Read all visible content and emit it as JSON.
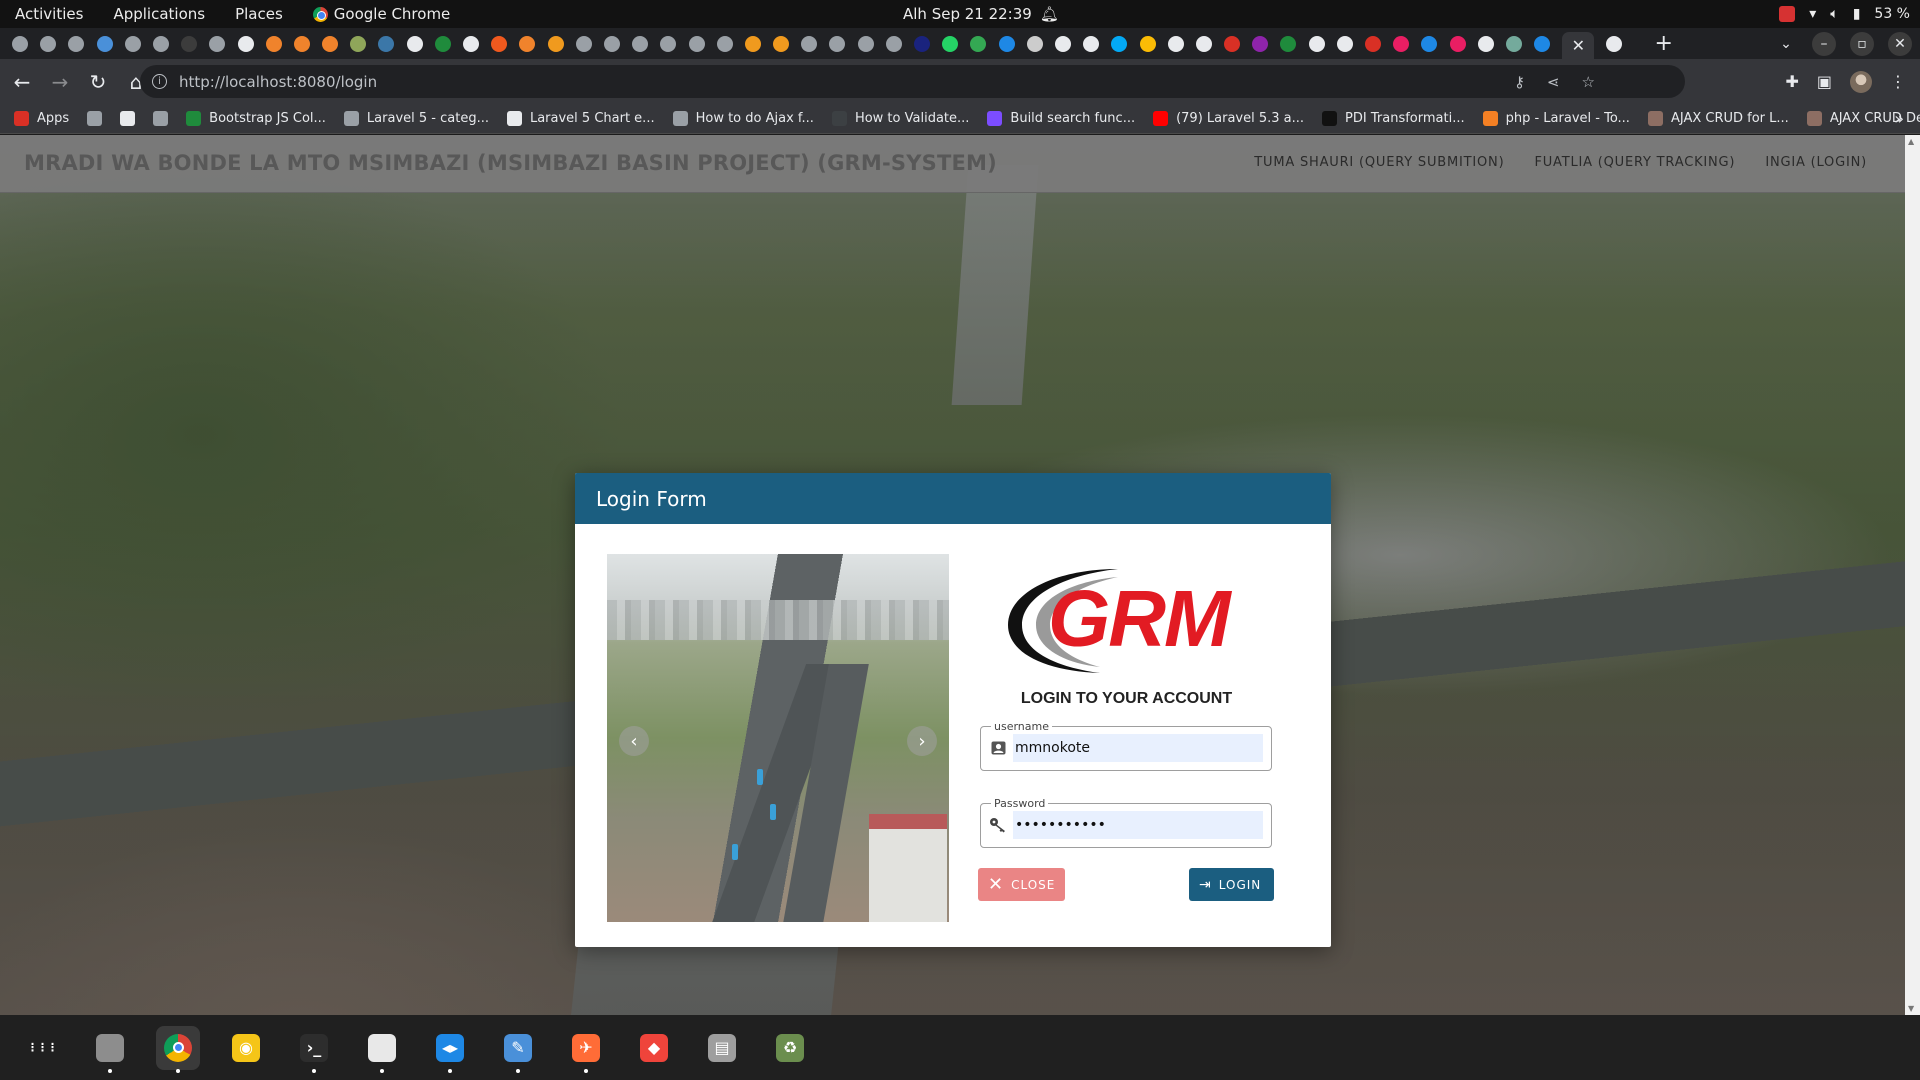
{
  "topbar": {
    "activities": "Activities",
    "applications": "Applications",
    "places": "Places",
    "app_name": "Google Chrome",
    "clock": "Alh Sep 21  22:39",
    "battery": "53 %"
  },
  "tabstrip": {
    "favicon_colors": [
      "#9aa0a6",
      "#9aa0a6",
      "#9aa0a6",
      "#4a90d9",
      "#9aa0a6",
      "#9aa0a6",
      "#3c3c3c",
      "#9aa0a6",
      "#e8eaed",
      "#f0832c",
      "#f0832c",
      "#f0832c",
      "#8fa65a",
      "#3b77a8",
      "#e8eaed",
      "#1f8b3c",
      "#e8eaed",
      "#f0591e",
      "#f0832c",
      "#f09a1e",
      "#9aa0a6",
      "#9aa0a6",
      "#9aa0a6",
      "#9aa0a6",
      "#9aa0a6",
      "#9aa0a6",
      "#f09a1e",
      "#f09a1e",
      "#9aa0a6",
      "#9aa0a6",
      "#9aa0a6",
      "#9aa0a6",
      "#1a237e",
      "#25d366",
      "#34a853",
      "#1e88e5",
      "#cccccc",
      "#e8eaed",
      "#e8eaed",
      "#03a9f4",
      "#fbbc05",
      "#e8eaed",
      "#e8eaed",
      "#d93025",
      "#8e24aa",
      "#1f8b3c",
      "#e8eaed",
      "#e8eaed",
      "#d93025",
      "#e91e63",
      "#1e88e5",
      "#e91e63",
      "#e8eaed",
      "#74aa9c",
      "#1e88e5"
    ],
    "active_tab_close": "✕",
    "newtab": "+"
  },
  "toolbar": {
    "url": "http://localhost:8080/login"
  },
  "bookmarks": [
    {
      "label": "Apps",
      "color": "#d93025"
    },
    {
      "label": "",
      "color": "#9aa0a6"
    },
    {
      "label": "",
      "color": "#e8eaed"
    },
    {
      "label": "",
      "color": "#9aa0a6"
    },
    {
      "label": "Bootstrap JS Col...",
      "color": "#1f8b3c"
    },
    {
      "label": "Laravel 5 - categ...",
      "color": "#9aa0a6"
    },
    {
      "label": "Laravel 5 Chart e...",
      "color": "#e8eaed"
    },
    {
      "label": "How to do Ajax f...",
      "color": "#9aa0a6"
    },
    {
      "label": "How to Validate...",
      "color": "#3c4043"
    },
    {
      "label": "Build search func...",
      "color": "#7c4dff"
    },
    {
      "label": "(79) Laravel 5.3 a...",
      "color": "#ff0000"
    },
    {
      "label": "PDI Transformati...",
      "color": "#111111"
    },
    {
      "label": "php - Laravel - To...",
      "color": "#f48024"
    },
    {
      "label": "AJAX CRUD for L...",
      "color": "#8d6e63"
    },
    {
      "label": "AJAX CRUD Demo",
      "color": "#8d6e63"
    }
  ],
  "site": {
    "title": "MRADI WA BONDE LA MTO MSIMBAZI (MSIMBAZI BASIN PROJECT) (GRM-SYSTEM)",
    "nav": [
      "TUMA SHAURI (QUERY SUBMITION)",
      "FUATLIA (QUERY TRACKING)",
      "INGIA (LOGIN)"
    ]
  },
  "modal": {
    "title": "Login Form",
    "logo_text": "GRM",
    "heading": "LOGIN TO YOUR ACCOUNT",
    "username_label": "username",
    "username_value": "mmnokote",
    "password_label": "Password",
    "password_value": "mmnokote123",
    "close_label": "CLOSE",
    "login_label": "LOGIN",
    "header_color": "#1b5e80",
    "close_color": "#ea8585",
    "logo_color": "#e21b23"
  },
  "dock": [
    {
      "name": "apps-grid",
      "color": "transparent",
      "glyph": "⋮⋮⋮"
    },
    {
      "name": "files",
      "color": "#8d8d8d",
      "glyph": ""
    },
    {
      "name": "chrome",
      "color": "#4285f4",
      "glyph": ""
    },
    {
      "name": "rhythmbox",
      "color": "#f5c518",
      "glyph": "◉"
    },
    {
      "name": "terminal",
      "color": "#2d2d2d",
      "glyph": "›_"
    },
    {
      "name": "inkscape",
      "color": "#e8e8e8",
      "glyph": ""
    },
    {
      "name": "vscode",
      "color": "#1e88e5",
      "glyph": "◂▸"
    },
    {
      "name": "text-editor",
      "color": "#4a90d9",
      "glyph": "✎"
    },
    {
      "name": "postman",
      "color": "#ff6c37",
      "glyph": "✈"
    },
    {
      "name": "anydesk",
      "color": "#ef443b",
      "glyph": "◆"
    },
    {
      "name": "file-manager",
      "color": "#9e9e9e",
      "glyph": "▤"
    },
    {
      "name": "trash",
      "color": "#6b8e4e",
      "glyph": "♻"
    }
  ]
}
